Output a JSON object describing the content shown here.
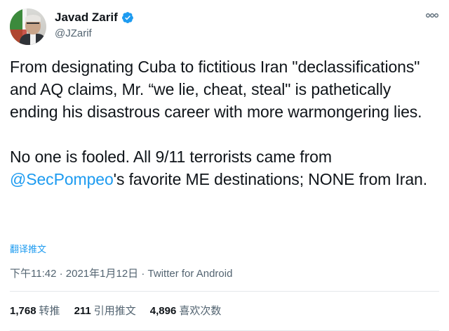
{
  "author": {
    "display_name": "Javad Zarif",
    "handle": "@JZarif",
    "verified": true,
    "avatar_icon": "profile-photo"
  },
  "tweet": {
    "paragraph1": "From designating Cuba to fictitious Iran \"declassifications\" and AQ claims, Mr. “we lie, cheat, steal\" is pathetically ending his disastrous career with more warmongering lies.",
    "paragraph2_before": "No one is fooled. All 9/11 terrorists came from ",
    "mention": "@SecPompeo",
    "paragraph2_after": "'s favorite ME destinations; NONE from Iran."
  },
  "translate_label": "翻译推文",
  "meta": {
    "time": "下午11:42",
    "separator": " · ",
    "date": "2021年1月12日",
    "client": "Twitter for Android"
  },
  "stats": {
    "retweets_count": "1,768",
    "retweets_label": "转推",
    "quotes_count": "211",
    "quotes_label": "引用推文",
    "likes_count": "4,896",
    "likes_label": "喜欢次数"
  },
  "colors": {
    "accent": "#1d9bf0",
    "text": "#0f1419",
    "secondary": "#536471"
  }
}
